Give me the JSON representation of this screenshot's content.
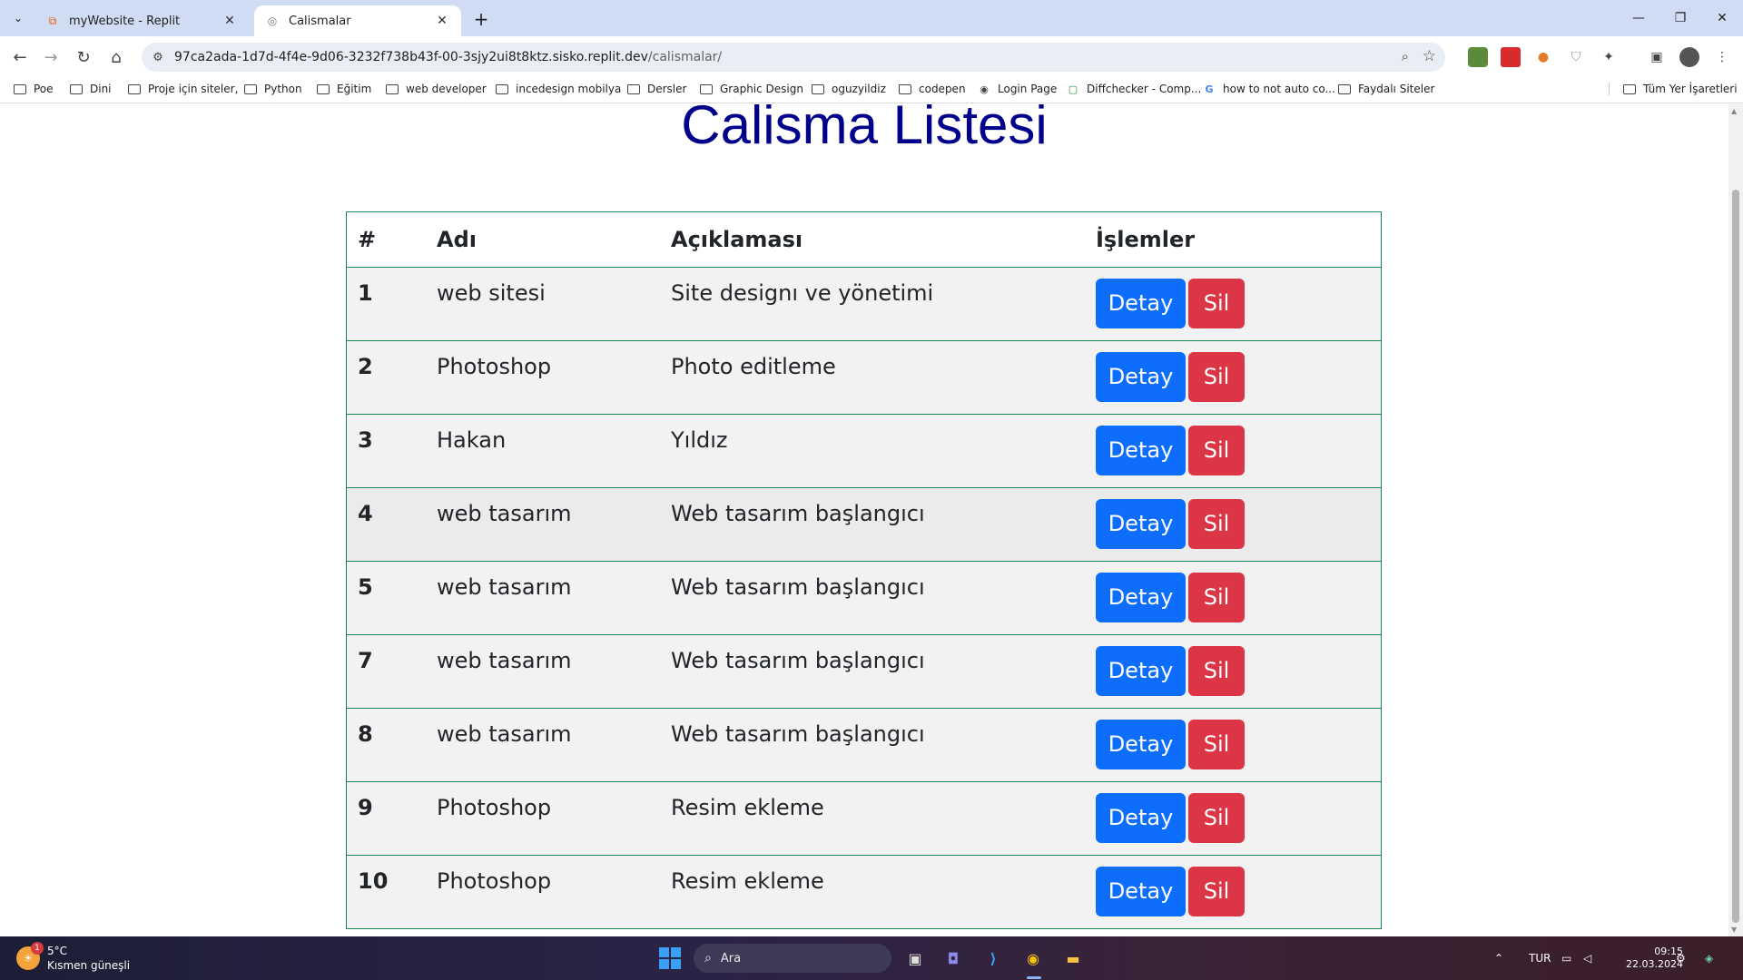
{
  "browser": {
    "tabs": [
      {
        "title": "myWebsite - Replit",
        "favicon": "replit-icon",
        "active": false
      },
      {
        "title": "Calismalar",
        "favicon": "globe-icon",
        "active": true
      }
    ],
    "url_host": "97ca2ada-1d7d-4f4e-9d06-3232f738b43f-00-3sjy2ui8t8ktz.sisko.replit.dev",
    "url_path": "/calismalar/",
    "bookmarks": [
      {
        "label": "Poe",
        "icon": "folder-icon"
      },
      {
        "label": "Dini",
        "icon": "folder-icon"
      },
      {
        "label": "Proje için siteler,",
        "icon": "folder-icon"
      },
      {
        "label": "Python",
        "icon": "folder-icon"
      },
      {
        "label": "Eğitim",
        "icon": "folder-icon"
      },
      {
        "label": "web developer",
        "icon": "folder-icon"
      },
      {
        "label": "incedesign mobilya",
        "icon": "folder-icon"
      },
      {
        "label": "Dersler",
        "icon": "folder-icon"
      },
      {
        "label": "Graphic Design",
        "icon": "folder-icon"
      },
      {
        "label": "oguzyildiz",
        "icon": "folder-icon"
      },
      {
        "label": "codepen",
        "icon": "folder-icon"
      },
      {
        "label": "Login Page",
        "icon": "globe-icon"
      },
      {
        "label": "Diffchecker - Comp...",
        "icon": "diffchecker-icon"
      },
      {
        "label": "how to not auto co...",
        "icon": "google-icon"
      },
      {
        "label": "Faydalı Siteler",
        "icon": "folder-icon"
      }
    ],
    "all_bookmarks_label": "Tüm Yer İşaretleri"
  },
  "page": {
    "title": "Calisma Listesi",
    "table": {
      "headers": [
        "#",
        "Adı",
        "Açıklaması",
        "İşlemler"
      ],
      "rows": [
        {
          "id": "1",
          "name": "web sitesi",
          "description": "Site designı ve yönetimi"
        },
        {
          "id": "2",
          "name": "Photoshop",
          "description": "Photo editleme"
        },
        {
          "id": "3",
          "name": "Hakan",
          "description": "Yıldız"
        },
        {
          "id": "4",
          "name": "web tasarım",
          "description": "Web tasarım başlangıcı"
        },
        {
          "id": "5",
          "name": "web tasarım",
          "description": "Web tasarım başlangıcı"
        },
        {
          "id": "7",
          "name": "web tasarım",
          "description": "Web tasarım başlangıcı"
        },
        {
          "id": "8",
          "name": "web tasarım",
          "description": "Web tasarım başlangıcı"
        },
        {
          "id": "9",
          "name": "Photoshop",
          "description": "Resim ekleme"
        },
        {
          "id": "10",
          "name": "Photoshop",
          "description": "Resim ekleme"
        }
      ],
      "detail_label": "Detay",
      "delete_label": "Sil"
    },
    "colors": {
      "title": "#00008b",
      "border": "#198754",
      "detail_button": "#0d6efd",
      "delete_button": "#dc3545"
    }
  },
  "taskbar": {
    "weather_temp": "5°C",
    "weather_desc": "Kısmen güneşli",
    "weather_badge": "1",
    "search_placeholder": "Ara",
    "language": "TUR",
    "time": "09:15",
    "date": "22.03.2024"
  }
}
